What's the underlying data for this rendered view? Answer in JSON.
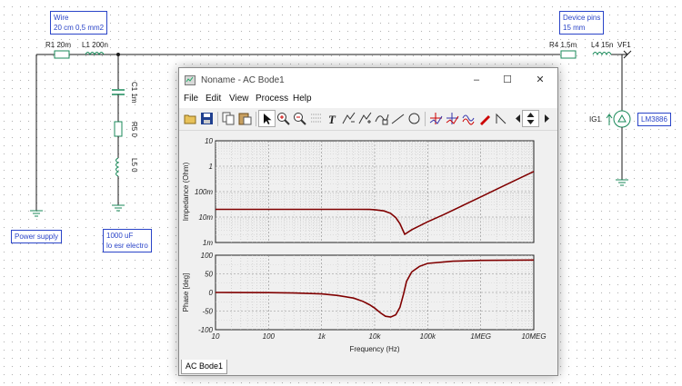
{
  "schematic": {
    "labels": {
      "r1": "R1 20m",
      "l1": "L1 200n",
      "c1": "C1 1m",
      "r5": "R5 0",
      "l5": "L5 0",
      "r4": "R4 1,5m",
      "l4": "L4 15n",
      "vf1": "VF1",
      "ig1": "IG1",
      "lm": "LM3886"
    },
    "notes": {
      "wire": "Wire\n20 cm 0,5 mm2",
      "device": "Device pins\n15 mm",
      "power": "Power supply",
      "cap": "1000 uF\nlo esr electro"
    }
  },
  "window": {
    "title": "Noname - AC Bode1",
    "controls": {
      "minimize": "–",
      "maximize": "☐",
      "close": "✕"
    },
    "menu": [
      "File",
      "Edit",
      "View",
      "Process",
      "Help"
    ],
    "toolbar_icons": [
      "open-icon",
      "save-icon",
      "copy-icon",
      "paste-icon",
      "select-icon",
      "zoom-in-icon",
      "zoom-out-icon",
      "grid-icon",
      "text-icon",
      "cursor-a-icon",
      "cursor-b-icon",
      "curve-icon",
      "line-icon",
      "circle-icon",
      "marker-a-icon",
      "marker-b-icon",
      "wave-icon",
      "pen-icon",
      "step-icon",
      "scroll-left-icon",
      "scroll-updown-icon",
      "scroll-right-icon"
    ],
    "tab_label": "AC Bode1"
  },
  "chart_data": [
    {
      "type": "line",
      "title": "",
      "xlabel": "Frequency (Hz)",
      "ylabel": "Impedance (Ohm)",
      "x_scale": "log",
      "y_scale": "log",
      "xlim": [
        10,
        10000000
      ],
      "ylim": [
        0.001,
        10
      ],
      "x_ticks": [
        "10",
        "100",
        "1k",
        "10k",
        "100k",
        "1MEG",
        "10MEG"
      ],
      "y_ticks": [
        "10",
        "1",
        "100m",
        "10m",
        "1m"
      ],
      "grid": true,
      "color": "#800000",
      "series": [
        {
          "x": [
            10,
            100,
            1000,
            5000,
            8000,
            10000,
            15000,
            20000,
            25000,
            30000,
            37000,
            50000,
            70000,
            100000,
            200000,
            500000,
            1000000,
            2000000,
            5000000,
            10000000
          ],
          "y": [
            0.0201,
            0.0201,
            0.0201,
            0.0201,
            0.0199,
            0.0195,
            0.0175,
            0.014,
            0.0095,
            0.0055,
            0.0021,
            0.0032,
            0.0045,
            0.0065,
            0.0125,
            0.031,
            0.062,
            0.125,
            0.31,
            0.62
          ]
        }
      ]
    },
    {
      "type": "line",
      "title": "",
      "xlabel": "Frequency (Hz)",
      "ylabel": "Phase [deg]",
      "x_scale": "log",
      "y_scale": "linear",
      "xlim": [
        10,
        10000000
      ],
      "ylim": [
        -100,
        100
      ],
      "x_ticks": [
        "10",
        "100",
        "1k",
        "10k",
        "100k",
        "1MEG",
        "10MEG"
      ],
      "y_ticks": [
        "100",
        "50",
        "0",
        "-50",
        "-100"
      ],
      "grid": true,
      "color": "#800000",
      "series": [
        {
          "x": [
            10,
            100,
            300,
            1000,
            2000,
            4000,
            6000,
            8000,
            10000,
            13000,
            16000,
            20000,
            25000,
            30000,
            35000,
            40000,
            50000,
            70000,
            100000,
            300000,
            1000000,
            10000000
          ],
          "y": [
            0,
            -0.5,
            -1.5,
            -4,
            -8,
            -15,
            -24,
            -33,
            -42,
            -55,
            -64,
            -66,
            -60,
            -40,
            -5,
            30,
            55,
            70,
            78,
            84,
            86,
            87
          ]
        }
      ]
    }
  ]
}
